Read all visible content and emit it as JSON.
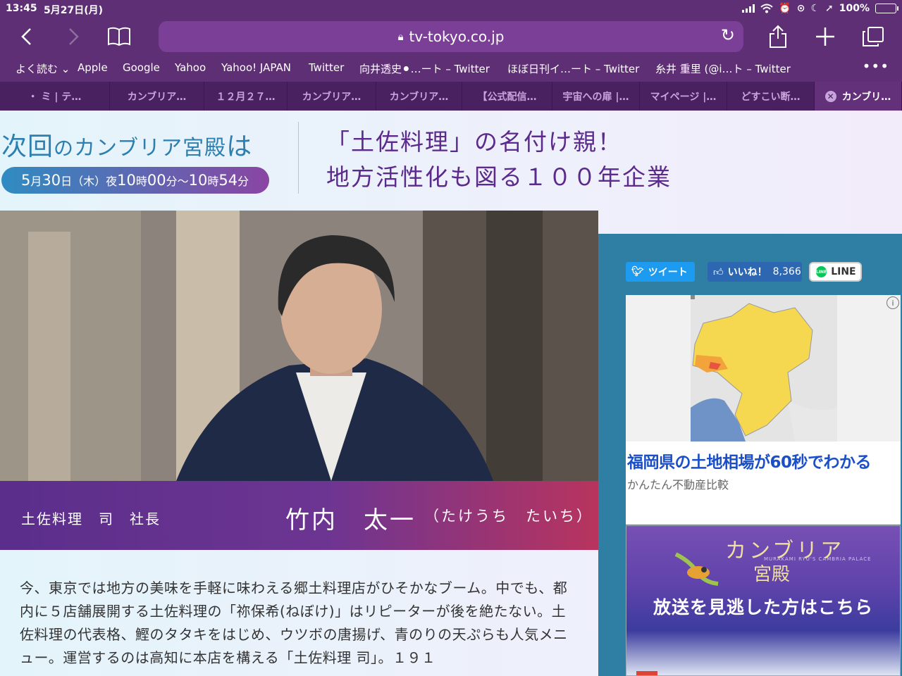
{
  "status_bar": {
    "time": "13:45",
    "date": "5月27日(月)",
    "battery": "100%"
  },
  "toolbar": {
    "address": "tv-tokyo.co.jp",
    "icons": [
      "back-icon",
      "forward-icon",
      "bookmarks-icon",
      "lock-icon",
      "reload-icon",
      "share-icon",
      "new-tab-icon",
      "tabs-icon"
    ]
  },
  "bookmarks": [
    {
      "label": "よく読む ⌄"
    },
    {
      "label": "Apple"
    },
    {
      "label": "Google"
    },
    {
      "label": "Yahoo"
    },
    {
      "label": "Yahoo! JAPAN"
    },
    {
      "label": "Twitter"
    },
    {
      "label": "向井透史⚫︎…ート – Twitter"
    },
    {
      "label": "ほぼ日刊イ…ート – Twitter"
    },
    {
      "label": "糸井 重里 (@i…ト – Twitter"
    }
  ],
  "tabs": [
    {
      "label": "・  ミ | テ…"
    },
    {
      "label": "カンブリア…"
    },
    {
      "label": "１２月２７…"
    },
    {
      "label": "カンブリア…"
    },
    {
      "label": "カンブリア…"
    },
    {
      "label": "【公式配信…"
    },
    {
      "label": "宇宙への扉 |…"
    },
    {
      "label": "マイページ |…"
    },
    {
      "label": "どすこい断…"
    },
    {
      "label": "カンブリ…"
    }
  ],
  "program": {
    "next_prefix": "次回",
    "next_mid": "の",
    "next_show": "カンブリア宮殿",
    "next_suffix": "は",
    "airtime": {
      "month": "5",
      "month_unit": "月",
      "day": "30",
      "day_unit": "日",
      "weekday": "（木）夜",
      "start_h": "10",
      "start_m": "00",
      "to": "分〜",
      "end_h": "10",
      "end_m": "54",
      "hour_unit": "時",
      "min_unit": "分"
    },
    "headline_line1": "「土佐料理」の名付け親！",
    "headline_line2": "地方活性化も図る１００年企業"
  },
  "guest": {
    "role": "土佐料理　司　社長",
    "name": "竹内　太一",
    "kana": "（たけうち　たいち）"
  },
  "article": {
    "text": "今、東京では地方の美味を手軽に味わえる郷土料理店がひそかなブーム。中でも、都内に５店舗展開する土佐料理の「祢保希(ねぼけ)」はリピーターが後を絶たない。土佐料理の代表格、鰹のタタキをはじめ、ウツボの唐揚げ、青のりの天ぷらも人気メニュー。運営するのは高知に本店を構える「土佐料理 司」。１９１"
  },
  "social": {
    "tweet": "ツイート",
    "like": "いいね！",
    "like_count": "8,366",
    "line": "LINE",
    "line_icon": "LINE"
  },
  "ad": {
    "title": "福岡県の土地相場が60秒でわかる",
    "subtitle": "かんたん不動産比較",
    "info_icon": "i"
  },
  "banner": {
    "logo_top": "カンブリア",
    "logo_bottom": "宮殿",
    "logo_sub": "MURAKAMI RYU'S CAMBRIA PALACE",
    "message": "放送を見逃した方はこちら"
  },
  "colors": {
    "chrome": "#5e2f74",
    "accent_blue": "#2d7fb0",
    "headline_purple": "#5b2a8c",
    "ad_link": "#1a4fc7",
    "sidebar": "#2f7ea3"
  }
}
